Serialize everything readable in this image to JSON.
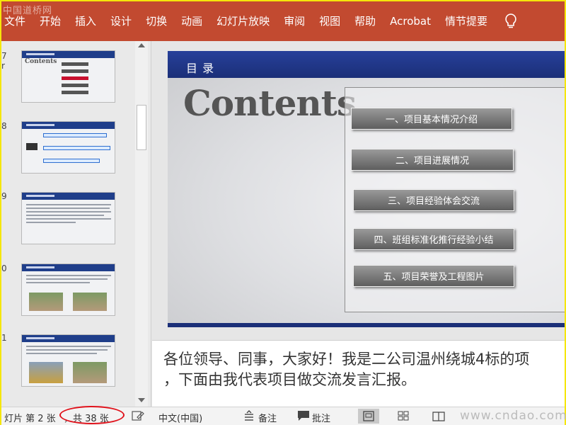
{
  "watermark": "中国道桥网",
  "ribbon": {
    "tabs": [
      "文件",
      "开始",
      "插入",
      "设计",
      "切换",
      "动画",
      "幻灯片放映",
      "审阅",
      "视图",
      "帮助",
      "Acrobat",
      "情节提要"
    ],
    "help_icon": "lightbulb-icon"
  },
  "thumbnails": {
    "numbers": [
      "7",
      "8",
      "9",
      "0",
      "1"
    ],
    "thumb1_title": "Contents"
  },
  "slide": {
    "header": "目 录",
    "title": "Contents",
    "toc": [
      "一、项目基本情况介绍",
      "二、项目进展情况",
      "三、项目经验体会交流",
      "四、班组标准化推行经验小结",
      "五、项目荣誉及工程图片"
    ]
  },
  "notes": {
    "line1": "各位领导、同事，大家好！我是二公司温州绕城4标的项",
    "line2": "，下面由我代表项目做交流发言汇报。"
  },
  "status": {
    "slide_info": "灯片 第 2 张",
    "total": "，共 38 张",
    "language": "中文(中国)",
    "notes_label": "备注",
    "comments_label": "批注",
    "site_watermark": "www.cndao.com",
    "highlight_color": "#e0121b"
  },
  "colors": {
    "ribbon": "#c24a30",
    "slide_header": "#1f3e8a",
    "border_highlight": "#f5e60a"
  }
}
